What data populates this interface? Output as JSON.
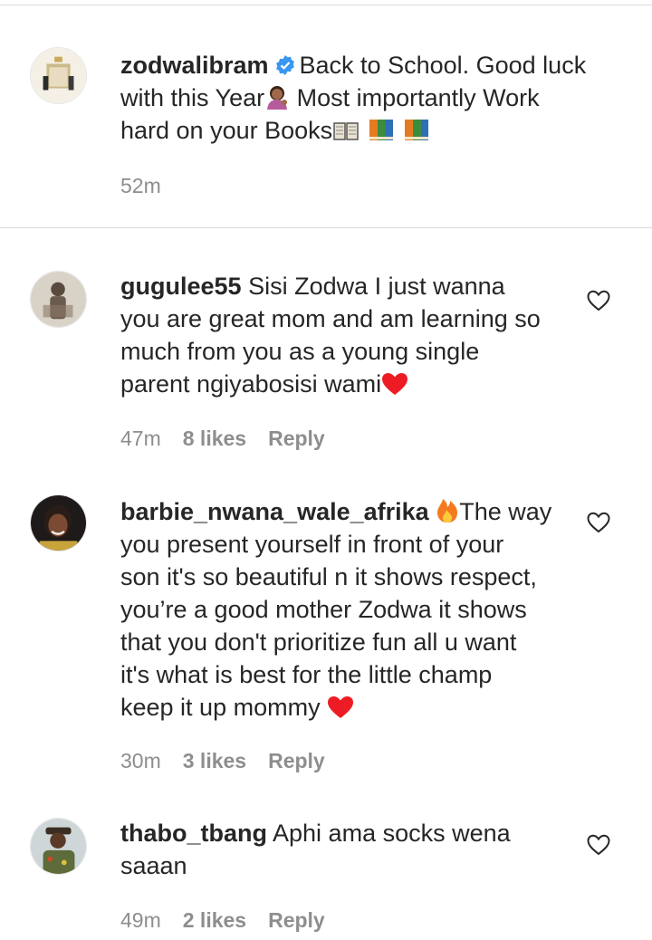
{
  "caption": {
    "username": "zodwalibram",
    "text_line1": "Back to School. Good luck",
    "text_line2a": "with this Year",
    "text_line2b": " Most importantly Work",
    "text_line3": "hard on your Books",
    "time": "52m"
  },
  "comments": [
    {
      "username": "gugulee55",
      "lines": [
        "Sisi Zodwa I just wanna",
        "you are great mom and am learning so",
        "much from you as a young single",
        "parent ngiyabosisi wami"
      ],
      "time": "47m",
      "likes": "8 likes",
      "reply": "Reply"
    },
    {
      "username": "barbie_nwana_wale_afrika",
      "lines": [
        "The way",
        "you present yourself in front of your",
        "son it's so beautiful n it shows respect,",
        "you’re a good mother Zodwa it shows",
        "that you don't prioritize fun all u want",
        "it's what is best for the little champ",
        "keep it up mommy"
      ],
      "time": "30m",
      "likes": "3 likes",
      "reply": "Reply"
    },
    {
      "username": "thabo_tbang",
      "lines": [
        "Aphi ama socks wena",
        "saaan"
      ],
      "time": "49m",
      "likes": "2 likes",
      "reply": "Reply"
    }
  ],
  "colors": {
    "text": "#262626",
    "meta": "#8e8e8e",
    "verified": "#3897f0",
    "heart_red": "#ed1c24"
  },
  "icons": [
    "verified-badge-icon",
    "woman-tipping-hand-emoji",
    "open-book-emoji",
    "books-emoji",
    "fire-emoji",
    "red-heart-emoji",
    "like-heart-icon"
  ]
}
